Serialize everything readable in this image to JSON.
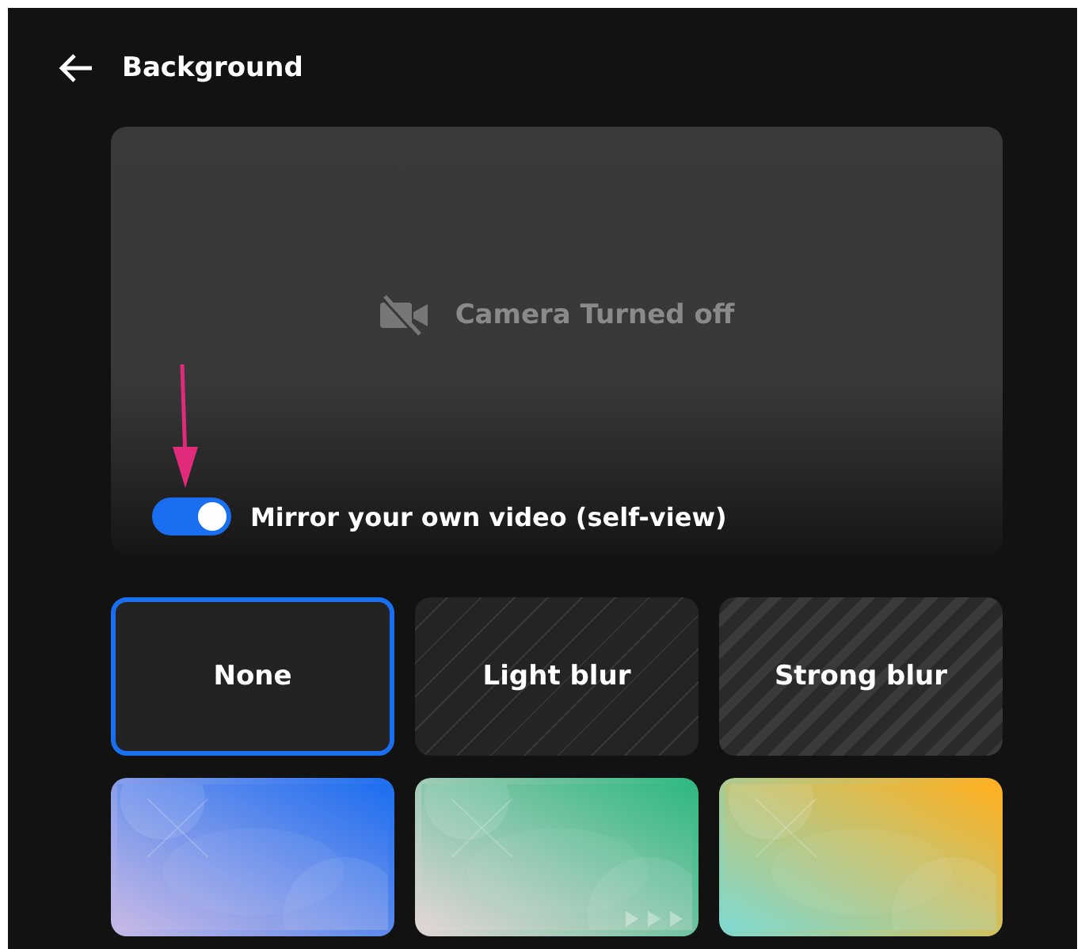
{
  "header": {
    "title": "Background"
  },
  "preview": {
    "status": "Camera Turned off",
    "mirror": {
      "label": "Mirror your own video (self-view)",
      "on": true
    }
  },
  "options": [
    {
      "kind": "none",
      "label": "None",
      "selected": true
    },
    {
      "kind": "light_blur",
      "label": "Light blur",
      "selected": false
    },
    {
      "kind": "strong_blur",
      "label": "Strong blur",
      "selected": false
    },
    {
      "kind": "picture",
      "selected": false
    },
    {
      "kind": "picture",
      "selected": false
    },
    {
      "kind": "picture",
      "selected": false
    }
  ]
}
